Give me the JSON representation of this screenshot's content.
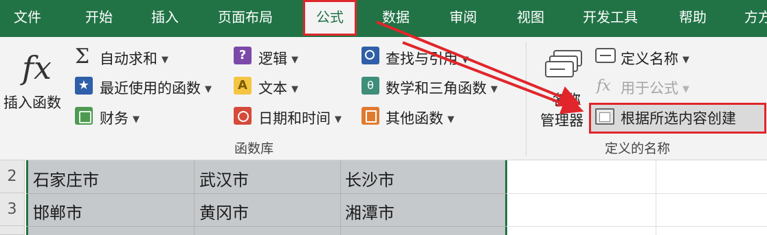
{
  "tabs": [
    "文件",
    "开始",
    "插入",
    "页面布局",
    "公式",
    "数据",
    "审阅",
    "视图",
    "开发工具",
    "帮助",
    "方方"
  ],
  "active_tab": "公式",
  "ribbon": {
    "insert_function": "插入函数",
    "autosum": "自动求和",
    "recent": "最近使用的函数",
    "financial": "财务",
    "logical": "逻辑",
    "text": "文本",
    "datetime": "日期和时间",
    "lookup": "查找与引用",
    "math": "数学和三角函数",
    "other": "其他函数",
    "library_label": "函数库",
    "name_manager_line1": "名称",
    "name_manager_line2": "管理器",
    "define_name": "定义名称",
    "use_in_formula": "用于公式",
    "create_from_selection": "根据所选内容创建",
    "defined_names_label": "定义的名称"
  },
  "icons": {
    "fx": "fx",
    "sigma": "Σ",
    "star": "★",
    "logic": "?",
    "text": "A",
    "math": "θ",
    "use": "fx"
  },
  "grid": {
    "rows": [
      {
        "num": "2",
        "cells": [
          "石家庄市",
          "武汉市",
          "长沙市"
        ]
      },
      {
        "num": "3",
        "cells": [
          "邯郸市",
          "黄冈市",
          "湘潭市"
        ]
      }
    ]
  },
  "colors": {
    "accent": "#217346",
    "highlight": "#e0262b",
    "selection": "#c6c9cc"
  }
}
